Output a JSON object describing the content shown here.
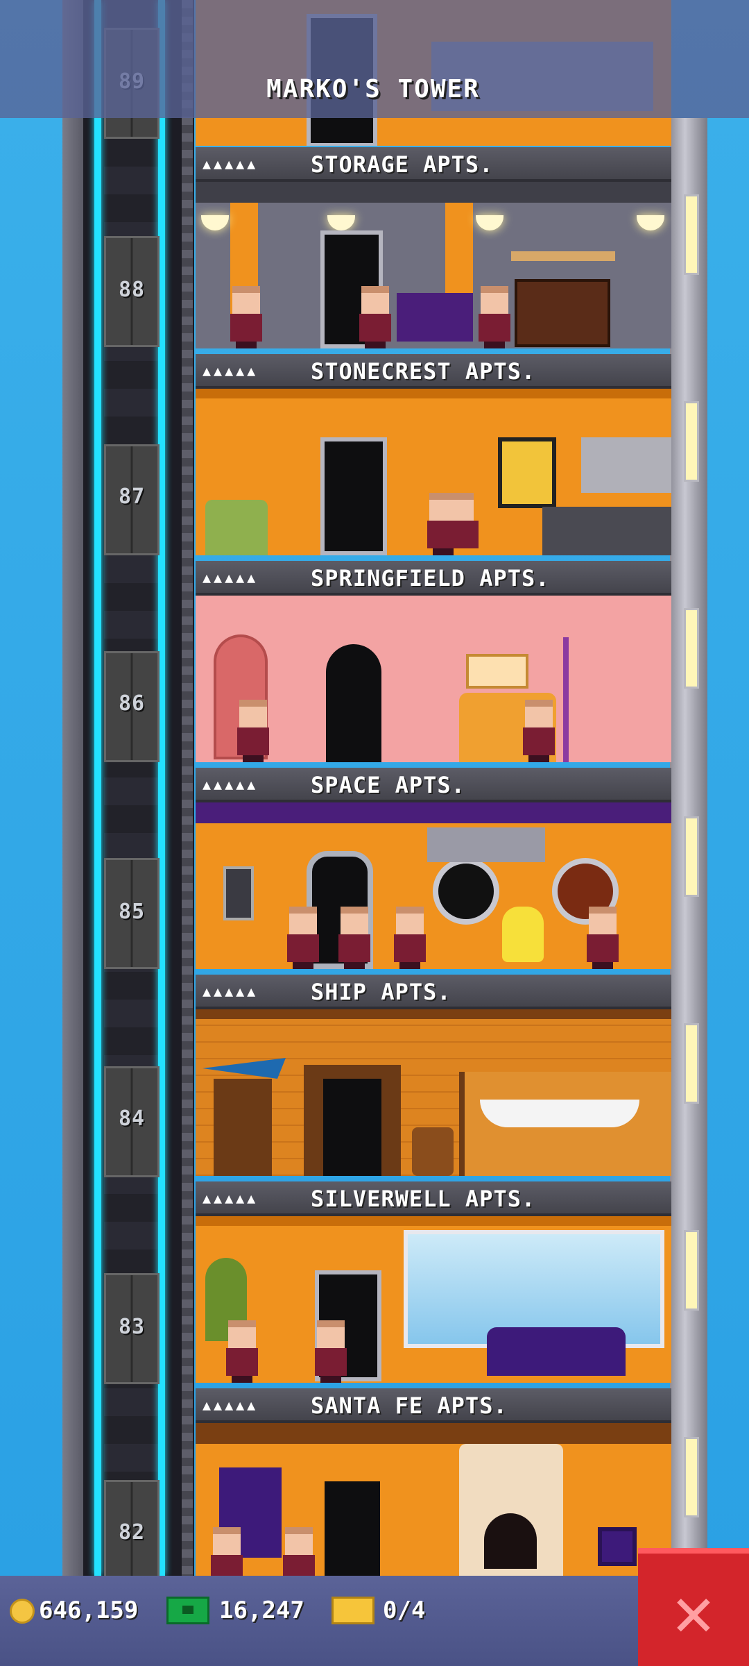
{
  "tower": {
    "title": "MARKO'S TOWER"
  },
  "elevator": {
    "floors": [
      {
        "label": "89"
      },
      {
        "label": "88"
      },
      {
        "label": "87"
      },
      {
        "label": "86"
      },
      {
        "label": "85"
      },
      {
        "label": "84"
      },
      {
        "label": "83"
      },
      {
        "label": "82"
      }
    ]
  },
  "floors": [
    {
      "name": "STORAGE APTS.",
      "rating": "▲▲▲▲▲",
      "color": "#f0921e"
    },
    {
      "name": "STONECREST APTS.",
      "rating": "▲▲▲▲▲",
      "color": "#f0921e"
    },
    {
      "name": "SPRINGFIELD APTS.",
      "rating": "▲▲▲▲▲",
      "color": "#f3a3a3"
    },
    {
      "name": "SPACE APTS.",
      "rating": "▲▲▲▲▲",
      "color": "#f0921e"
    },
    {
      "name": "SHIP APTS.",
      "rating": "▲▲▲▲▲",
      "color": "#dd8420"
    },
    {
      "name": "SILVERWELL APTS.",
      "rating": "▲▲▲▲▲",
      "color": "#f0921e"
    },
    {
      "name": "SANTA FE APTS.",
      "rating": "▲▲▲▲▲",
      "color": "#f0921e"
    }
  ],
  "status": {
    "coins": "646,159",
    "bux": "16,247",
    "tickets": "0/4"
  },
  "colors": {
    "accent": "#23e1ff",
    "close": "#d3252b"
  }
}
